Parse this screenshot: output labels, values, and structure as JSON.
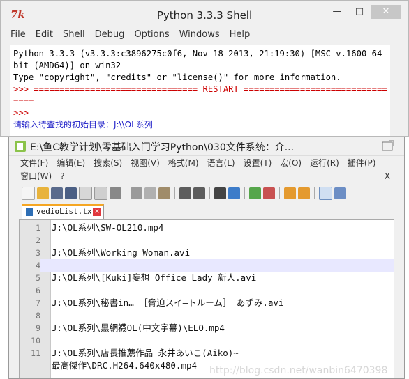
{
  "shell": {
    "logo": "7k",
    "title": "Python 3.3.3 Shell",
    "window_buttons": {
      "minimize": "—",
      "maximize": "□",
      "close": "✕"
    },
    "menu": [
      "File",
      "Edit",
      "Shell",
      "Debug",
      "Options",
      "Windows",
      "Help"
    ],
    "output": {
      "line1": "Python 3.3.3 (v3.3.3:c3896275c0f6, Nov 18 2013, 21:19:30) [MSC v.1600 64 bit (AMD64)] on win32",
      "line2": "Type \"copyright\", \"credits\" or \"license()\" for more information.",
      "restart": ">>> ================================ RESTART ================================",
      "prompt": ">>>",
      "input_prompt": "请输入待查找的初始目录：J:\\\\OL系列"
    }
  },
  "npp": {
    "title": "E:\\鱼C教学计划\\零基础入门学习Python\\030文件系统：介...",
    "menu": [
      "文件(F)",
      "编辑(E)",
      "搜索(S)",
      "视图(V)",
      "格式(M)",
      "语言(L)",
      "设置(T)",
      "宏(O)",
      "运行(R)",
      "插件(P)",
      "窗口(W)",
      "?"
    ],
    "close_x": "X",
    "tab_label": "vedioList.txt",
    "tab_close": "x",
    "lines": [
      {
        "num": "1",
        "text": "J:\\OL系列\\SW-OL210.mp4"
      },
      {
        "num": "2",
        "text": ""
      },
      {
        "num": "3",
        "text": "J:\\OL系列\\Working Woman.avi"
      },
      {
        "num": "4",
        "text": ""
      },
      {
        "num": "5",
        "text": "J:\\OL系列\\[Kuki]妄想 Office Lady 新人.avi"
      },
      {
        "num": "6",
        "text": ""
      },
      {
        "num": "7",
        "text": "J:\\OL系列\\秘書in… ［脅迫スイ―トルーム］ あずみ.avi"
      },
      {
        "num": "8",
        "text": ""
      },
      {
        "num": "9",
        "text": "J:\\OL系列\\黒網襪OL(中文字幕)\\ELO.mp4"
      },
      {
        "num": "10",
        "text": ""
      },
      {
        "num": "11",
        "text": "J:\\OL系列\\店長推薦作品 永井あいこ(Aiko)~"
      },
      {
        "num": "",
        "text": "最高傑作\\DRC.H264.640x480.mp4"
      }
    ]
  },
  "watermark": "http://blog.csdn.net/wanbin6470398"
}
